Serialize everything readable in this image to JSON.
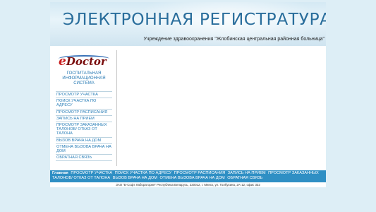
{
  "banner": {
    "title": "ЭЛЕКТРОННАЯ РЕГИСТРАТУРА",
    "subtitle": "Учреждение здравоохранения \"Жлобинская центральная районная больница\""
  },
  "logo": {
    "text_e": "e",
    "text_rest": "Doctor"
  },
  "sidebar": {
    "system_title": "ГОСПИТАЛЬНАЯ\nИНФОРМАЦИОННАЯ\nСИСТЕМА",
    "items": [
      "ПРОСМОТР УЧАСТКА",
      "ПОИСК УЧАСТКА ПО АДРЕСУ",
      "ПРОСМОТР РАСПИСАНИЯ",
      "ЗАПИСЬ НА ПРИЕМ",
      "ПРОСМОТР ЗАКАЗАННЫХ ТАЛОНОВ/ ОТКАЗ ОТ ТАЛОНА",
      "ВЫЗОВ ВРАЧА НА ДОМ",
      "ОТМЕНА ВЫЗОВА ВРАЧА НА ДОМ",
      "ОБРАТНАЯ СВЯЗЬ"
    ]
  },
  "footer": {
    "home": "Главная",
    "links": [
      "ПРОСМОТР УЧАСТКА",
      "ПОИСК УЧАСТКА ПО АДРЕСУ",
      "ПРОСМОТР РАСПИСАНИЯ",
      "ЗАПИСЬ НА ПРИЕМ",
      "ПРОСМОТР ЗАКАЗАННЫХ ТАЛОНОВ/ ОТКАЗ ОТ ТАЛОНА",
      "ВЫЗОВ ВРАЧА НА ДОМ",
      "ОТМЕНА ВЫЗОВА ВРАЧА НА ДОМ",
      "ОБРАТНАЯ СВЯЗЬ"
    ],
    "copyright": "ЗАО \"Б-Софт Лаборатория\" Республика Беларусь, 220012, г. Минск, ул. Толбухина, 2А-12, офис 332"
  },
  "colors": {
    "accent": "#2f8fc4",
    "link": "#2b7fb8",
    "title": "#2a6e9c",
    "background": "#ddeef6"
  }
}
